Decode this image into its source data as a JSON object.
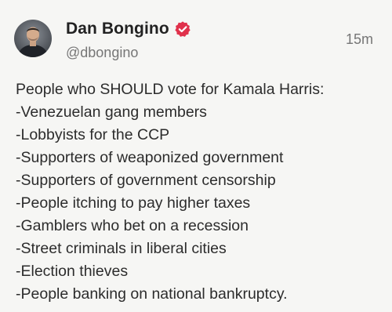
{
  "author": {
    "display_name": "Dan Bongino",
    "handle": "@dbongino",
    "verified": true
  },
  "timestamp": "15m",
  "colors": {
    "verified_badge": "#e0314b",
    "background": "#f6f6f4",
    "secondary_text": "#767676"
  },
  "icons": {
    "verified": "verified-badge-icon",
    "avatar": "avatar-photo"
  },
  "post": {
    "lines": [
      "People who SHOULD vote for Kamala Harris:",
      "-Venezuelan gang members",
      "-Lobbyists for the CCP",
      "-Supporters of weaponized government",
      "-Supporters of government censorship",
      "-People itching to pay higher taxes",
      "-Gamblers who bet on a recession",
      "-Street criminals in liberal cities",
      "-Election thieves",
      "-People banking on national bankruptcy."
    ]
  }
}
